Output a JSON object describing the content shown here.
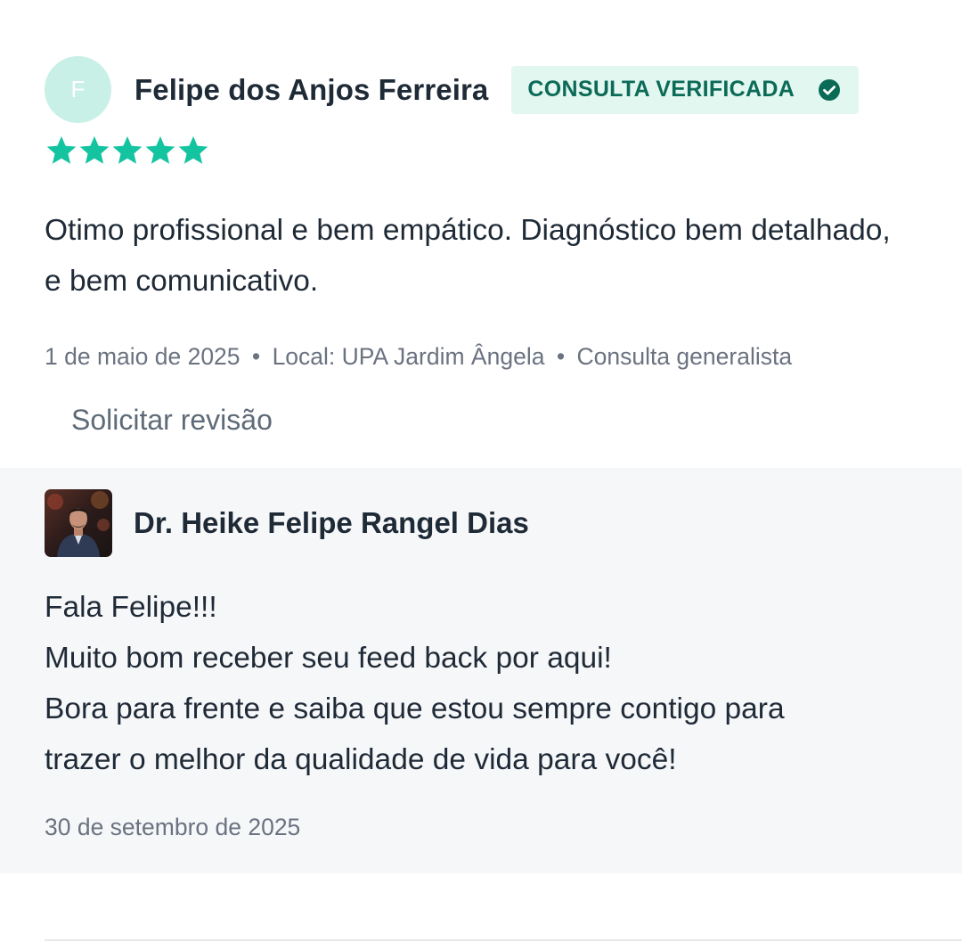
{
  "review": {
    "reviewer_initial": "F",
    "reviewer_name": "Felipe dos Anjos Ferreira",
    "badge_label": "CONSULTA VERIFICADA",
    "rating": 5,
    "rating_max": 5,
    "text": "Otimo profissional e bem empático. Diagnóstico bem detalhado, e bem comunicativo.",
    "meta": {
      "date": "1 de maio de 2025",
      "location": "Local: UPA Jardim Ângela",
      "service": "Consulta generalista",
      "separator": "•"
    },
    "request_review_label": "Solicitar revisão"
  },
  "reply": {
    "doctor_name": "Dr. Heike Felipe Rangel Dias",
    "lines": [
      "Fala Felipe!!!",
      "Muito bom receber seu feed back por aqui!",
      "Bora para frente e saiba que estou sempre contigo para",
      "trazer o melhor da qualidade de vida para você!"
    ],
    "date": "30 de setembro de 2025"
  },
  "icons": {
    "verified": "check-circle-icon",
    "rating": "star-icon"
  },
  "colors": {
    "star": "#14c4a0",
    "badge_bg": "#e3f7f1",
    "badge_text": "#0b6b57",
    "avatar_bg": "#c9f0e6",
    "reply_bg": "#f6f7f9",
    "meta_text": "#6b7280"
  }
}
